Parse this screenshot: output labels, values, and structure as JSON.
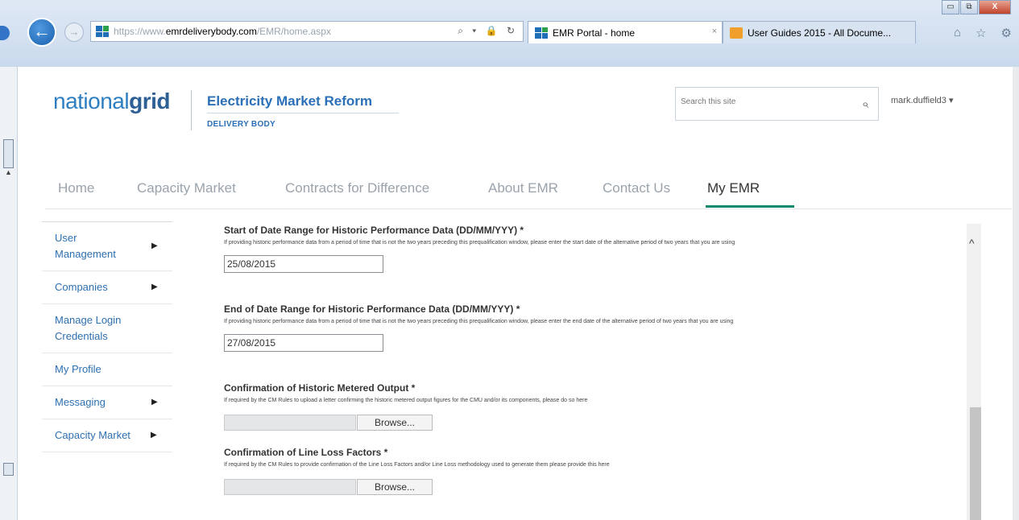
{
  "browser": {
    "url_prefix": "https://www.",
    "url_domain": "emrdeliverybody.com",
    "url_path": "/EMR/home.aspx",
    "addr_tools": "⌕ ▾ 🔒 ↻",
    "active_tab": "EMR Portal - home",
    "active_tab_close": "×",
    "inactive_tab": "User Guides 2015 - All Docume...",
    "back_glyph": "←",
    "forward_glyph": "→",
    "minimize_glyph": "▭",
    "restore_glyph": "⧉",
    "close_glyph": "X",
    "home_glyph": "⌂",
    "star_glyph": "☆",
    "gear_glyph": "⚙"
  },
  "header": {
    "logo_light": "national",
    "logo_bold": "grid",
    "title": "Electricity Market Reform",
    "subtitle": "DELIVERY BODY",
    "search_placeholder": "Search this site",
    "search_glyph": "⌕",
    "user_name": "mark.duffield3 ▾"
  },
  "nav": {
    "items": [
      "Home",
      "Capacity Market",
      "Contracts for Difference",
      "About EMR",
      "Contact Us",
      "My EMR"
    ],
    "active_index": 5
  },
  "sidebar": {
    "items": [
      {
        "label": "User Management",
        "arrow": "▶"
      },
      {
        "label": "Companies",
        "arrow": "▶"
      },
      {
        "label": "Manage Login Credentials",
        "arrow": ""
      },
      {
        "label": "My Profile",
        "arrow": ""
      },
      {
        "label": "Messaging",
        "arrow": "▶"
      },
      {
        "label": "Capacity Market",
        "arrow": "▶"
      }
    ]
  },
  "form": {
    "start_date": {
      "label": "Start of Date Range for Historic Performance Data (DD/MM/YYY) *",
      "help": "If providing historic performance data from a period of time that is not the two years preceding this prequalification window, please enter the start date of the alternative period of two years that you are using",
      "value": "25/08/2015"
    },
    "end_date": {
      "label": "End of Date Range for Historic Performance Data (DD/MM/YYY) *",
      "help": "If providing historic performance data from a period of time that is not the two years preceding this prequalification window, please enter the end date of the alternative period of two years that you are using",
      "value": "27/08/2015"
    },
    "metered_output": {
      "label": "Confirmation of Historic Metered Output *",
      "help": "If required by the CM Rules to upload a letter confirming the historic metered output figures for the CMU and/or its components, please do so here",
      "browse_label": "Browse..."
    },
    "line_loss": {
      "label": "Confirmation of Line Loss Factors *",
      "help": "If required by the CM Rules to provide confirmation of the Line Loss Factors and/or Line Loss methodology used to generate them please provide this here",
      "browse_label": "Browse..."
    }
  },
  "scrollbar": {
    "up_glyph": "^"
  }
}
